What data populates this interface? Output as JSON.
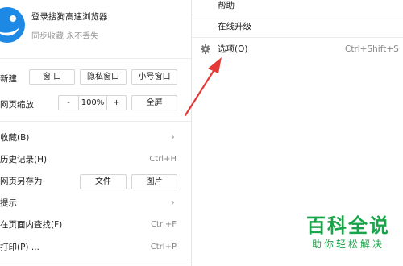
{
  "login": {
    "title": "登录搜狗高速浏览器",
    "subtitle": "同步收藏 永不丢失"
  },
  "new_row": {
    "label": "新建",
    "window": "窗 口",
    "private_window": "隐私窗口",
    "small_window": "小号窗口"
  },
  "zoom_row": {
    "label": "网页缩放",
    "minus": "-",
    "value": "100%",
    "plus": "+",
    "fullscreen": "全屏"
  },
  "menu": {
    "favorites": {
      "label": "收藏(B)"
    },
    "history": {
      "label": "历史记录(H)",
      "shortcut": "Ctrl+H"
    },
    "save_as": {
      "label": "网页另存为",
      "file": "文件",
      "image": "图片"
    },
    "tips": {
      "label": "提示"
    },
    "find": {
      "label": "在页面内查找(F)",
      "shortcut": "Ctrl+F"
    },
    "print": {
      "label": "打印(P) ...",
      "shortcut": "Ctrl+P"
    }
  },
  "right_menu": {
    "help": {
      "label": "帮助"
    },
    "update": {
      "label": "在线升级"
    },
    "options": {
      "label": "选项(O)",
      "shortcut": "Ctrl+Shift+S"
    }
  },
  "watermark": {
    "title": "百科全说",
    "subtitle": "助你轻松解决"
  },
  "colors": {
    "logo_blue": "#1e88e5",
    "arrow_red": "#e53935",
    "watermark_green": "#1aa44a"
  },
  "icons": [
    "sogou-logo-icon",
    "gear-icon",
    "chevron-right-icon",
    "annotation-arrow"
  ]
}
